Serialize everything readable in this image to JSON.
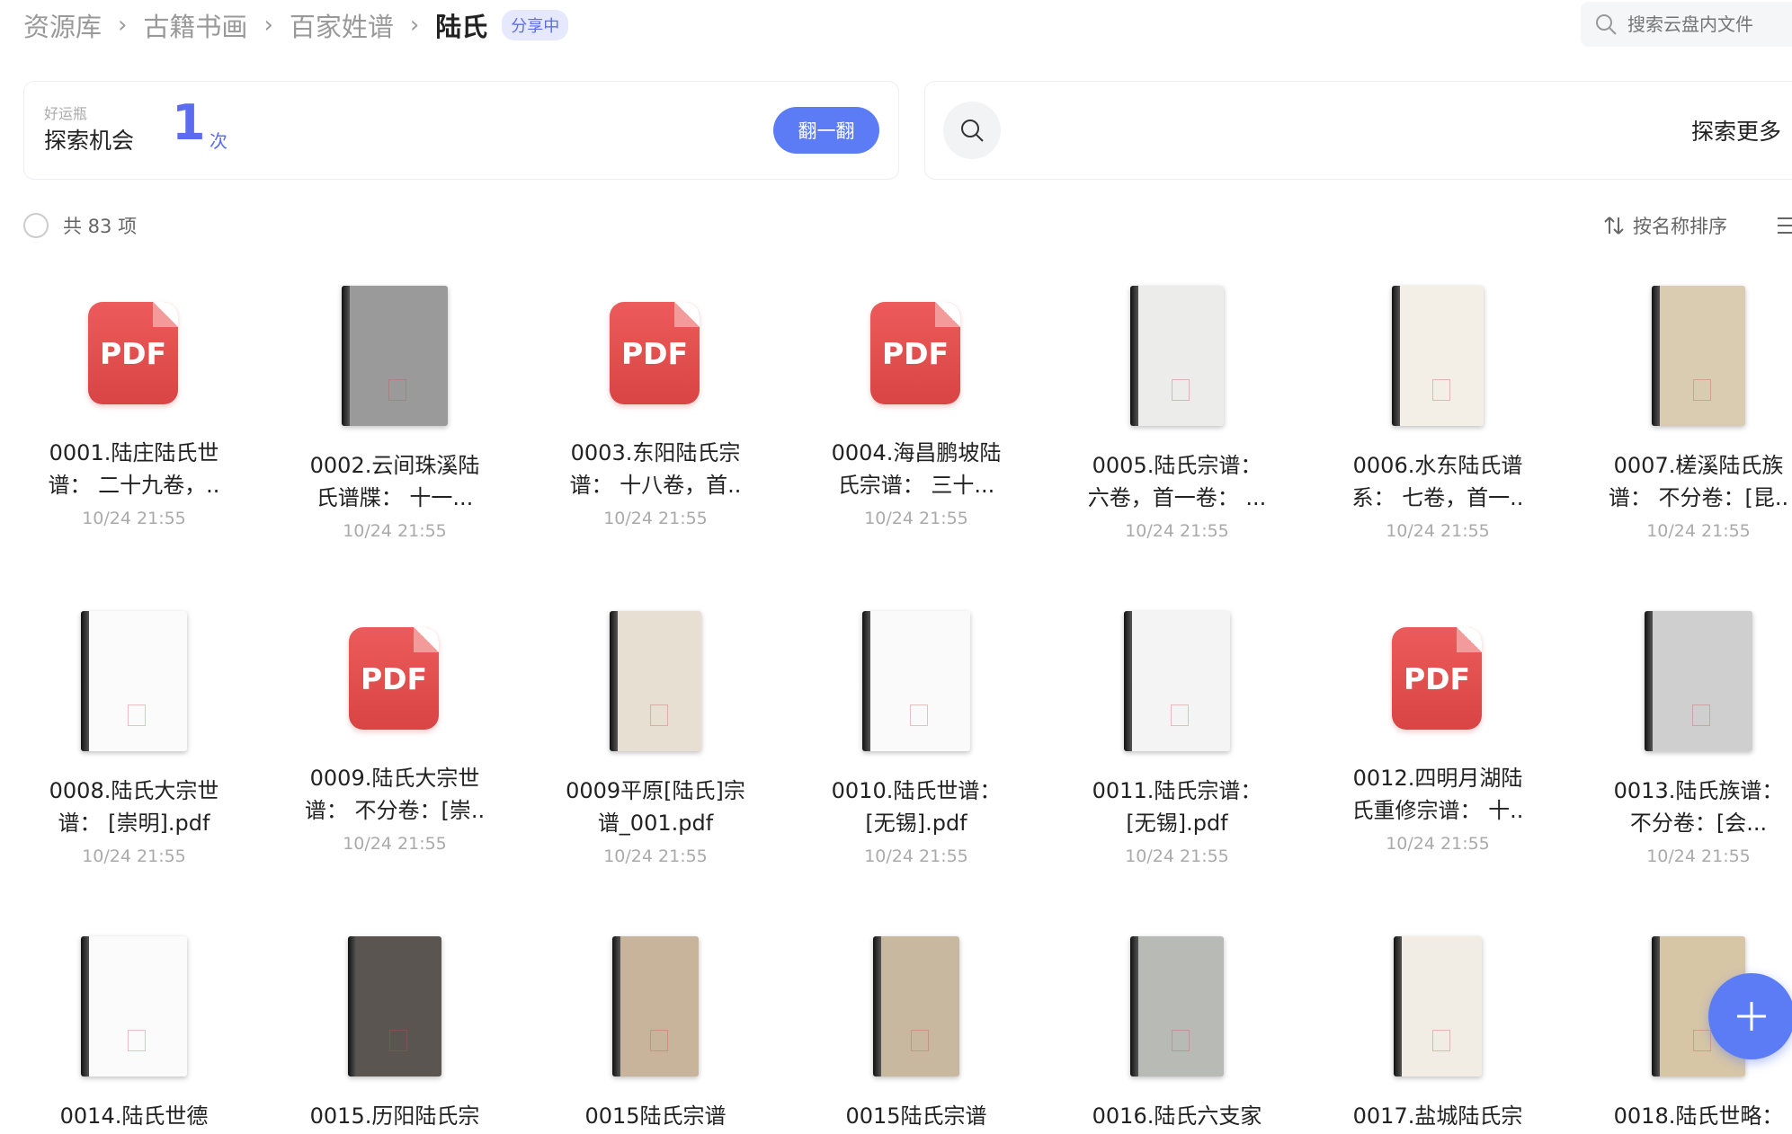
{
  "breadcrumb": [
    "资源库",
    "古籍书画",
    "百家姓谱",
    "陆氏"
  ],
  "share_badge": "分享中",
  "search": {
    "placeholder": "搜索云盘内文件"
  },
  "lucky": {
    "small_label": "好运瓶",
    "title": "探索机会",
    "count": "1",
    "unit": "次",
    "button": "翻一翻"
  },
  "explore": {
    "label": "探索更多"
  },
  "list": {
    "count_text": "共 83 项",
    "sort_label": "按名称排序"
  },
  "files": [
    {
      "name": [
        "0001.陆庄陆氏世",
        "谱：  二十九卷，.."
      ],
      "date": "10/24 21:55",
      "kind": "pdf"
    },
    {
      "name": [
        "0002.云间珠溪陆",
        "氏谱牒：  十一..."
      ],
      "date": "10/24 21:55",
      "kind": "book",
      "color": "#9a9a9a"
    },
    {
      "name": [
        "0003.东阳陆氏宗",
        "谱：  十八卷，首.."
      ],
      "date": "10/24 21:55",
      "kind": "pdf"
    },
    {
      "name": [
        "0004.海昌鹏坡陆",
        "氏宗谱：  三十..."
      ],
      "date": "10/24 21:55",
      "kind": "pdf"
    },
    {
      "name": [
        "0005.陆氏宗谱：",
        "六卷，首一卷：  ..."
      ],
      "date": "10/24 21:55",
      "kind": "book",
      "color": "#ececea"
    },
    {
      "name": [
        "0006.水东陆氏谱",
        "系：  七卷，首一.."
      ],
      "date": "10/24 21:55",
      "kind": "book",
      "color": "#f3efe6"
    },
    {
      "name": [
        "0007.槎溪陆氏族",
        "谱：  不分卷：[昆.."
      ],
      "date": "10/24 21:55",
      "kind": "book",
      "color": "#d9ccb0"
    },
    {
      "name": [
        "0008.陆氏大宗世",
        "谱：  [崇明].pdf"
      ],
      "date": "10/24 21:55",
      "kind": "book",
      "color": "#fbfbfb"
    },
    {
      "name": [
        "0009.陆氏大宗世",
        "谱：  不分卷：[崇.."
      ],
      "date": "10/24 21:55",
      "kind": "pdf"
    },
    {
      "name": [
        "0009平原[陆氏]宗",
        "谱_001.pdf"
      ],
      "date": "10/24 21:55",
      "kind": "book",
      "color": "#e6dfd2"
    },
    {
      "name": [
        "0010.陆氏世谱：",
        "[无锡].pdf"
      ],
      "date": "10/24 21:55",
      "kind": "book",
      "color": "#fafafa"
    },
    {
      "name": [
        "0011.陆氏宗谱：",
        "[无锡].pdf"
      ],
      "date": "10/24 21:55",
      "kind": "book",
      "color": "#f4f4f4"
    },
    {
      "name": [
        "0012.四明月湖陆",
        "氏重修宗谱：  十.."
      ],
      "date": "10/24 21:55",
      "kind": "pdf"
    },
    {
      "name": [
        "0013.陆氏族谱：",
        "不分卷：[会..."
      ],
      "date": "10/24 21:55",
      "kind": "book",
      "color": "#cfcfcf"
    },
    {
      "name": [
        "0014.陆氏世德",
        ""
      ],
      "date": "",
      "kind": "book",
      "color": "#fbfbfb"
    },
    {
      "name": [
        "0015.历阳陆氏宗",
        ""
      ],
      "date": "",
      "kind": "book",
      "color": "#5a5550"
    },
    {
      "name": [
        "0015陆氏宗谱",
        ""
      ],
      "date": "",
      "kind": "book",
      "color": "#c8b49a"
    },
    {
      "name": [
        "0015陆氏宗谱",
        ""
      ],
      "date": "",
      "kind": "book",
      "color": "#c9b8a0"
    },
    {
      "name": [
        "0016.陆氏六支家",
        ""
      ],
      "date": "",
      "kind": "book",
      "color": "#b8bab5"
    },
    {
      "name": [
        "0017.盐城陆氏宗",
        ""
      ],
      "date": "",
      "kind": "book",
      "color": "#f1ede4"
    },
    {
      "name": [
        "0018.陆氏世略：",
        ""
      ],
      "date": "",
      "kind": "book",
      "color": "#d7c6a6"
    }
  ]
}
